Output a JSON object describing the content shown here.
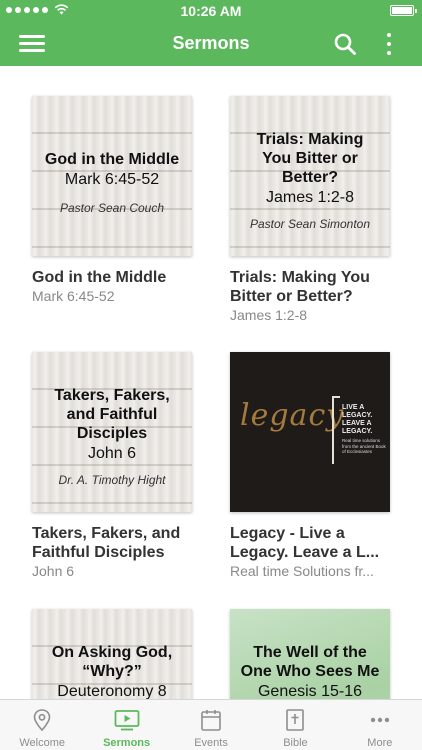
{
  "status_bar": {
    "time": "10:26 AM"
  },
  "header": {
    "title": "Sermons"
  },
  "colors": {
    "accent": "#5cb85c",
    "inactive": "#8e8e8e"
  },
  "sermons": [
    {
      "thumb": {
        "title": "God in the Middle",
        "ref": "Mark 6:45-52",
        "pastor": "Pastor Sean Couch"
      },
      "title": "God in the Middle",
      "subtitle": "Mark 6:45-52"
    },
    {
      "thumb": {
        "title": "Trials: Making You Bitter or Better?",
        "ref": "James 1:2-8",
        "pastor": "Pastor Sean Simonton"
      },
      "title": "Trials: Making You Bitter or Better?",
      "subtitle": "James 1:2-8"
    },
    {
      "thumb": {
        "title": "Takers, Fakers, and Faithful Disciples",
        "ref": "John 6",
        "pastor": "Dr. A. Timothy Hight"
      },
      "title": "Takers, Fakers, and Faithful Disciples",
      "subtitle": "John 6"
    },
    {
      "thumb": {
        "script": "legacy",
        "tag": "LIVE A LEGACY. LEAVE A LEGACY.",
        "small": "Real time solutions from the ancient Book of Ecclesiastes"
      },
      "title": "Legacy - Live a Legacy. Leave a L...",
      "subtitle": "Real time Solutions fr..."
    },
    {
      "thumb": {
        "title": "On Asking God, “Why?”",
        "ref": "Deuteronomy 8"
      }
    },
    {
      "thumb": {
        "title": "The Well of the One Who Sees Me",
        "ref": "Genesis 15-16"
      }
    }
  ],
  "tabs": [
    {
      "label": "Welcome",
      "icon": "location-pin-icon",
      "active": false
    },
    {
      "label": "Sermons",
      "icon": "tv-play-icon",
      "active": true
    },
    {
      "label": "Events",
      "icon": "calendar-icon",
      "active": false
    },
    {
      "label": "Bible",
      "icon": "bible-cross-icon",
      "active": false
    },
    {
      "label": "More",
      "icon": "ellipsis-icon",
      "active": false
    }
  ]
}
